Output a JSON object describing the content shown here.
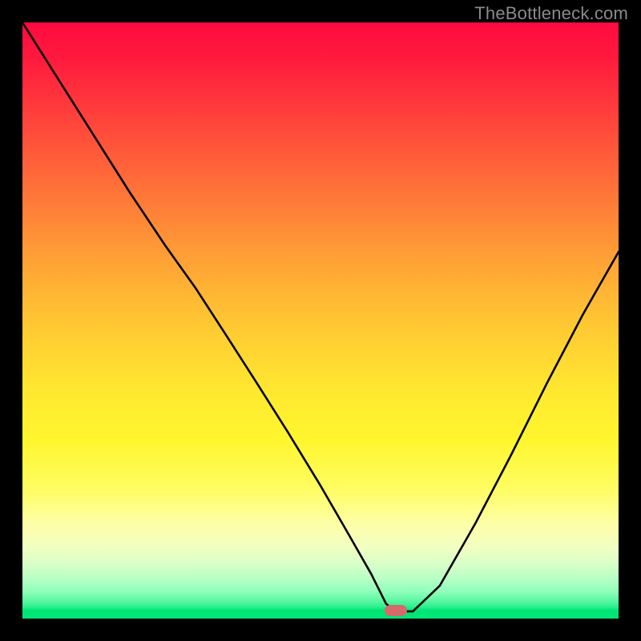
{
  "watermark": "TheBottleneck.com",
  "marker": {
    "color": "#d66a6a",
    "x_frac": 0.626,
    "y_frac": 0.987,
    "w": 28,
    "h": 14
  },
  "chart_data": {
    "type": "line",
    "title": "",
    "xlabel": "",
    "ylabel": "",
    "xlim": [
      0,
      1
    ],
    "ylim": [
      0,
      1
    ],
    "grid": false,
    "legend": false,
    "series": [
      {
        "name": "bottleneck-curve",
        "x": [
          0.0,
          0.06,
          0.12,
          0.18,
          0.24,
          0.29,
          0.34,
          0.39,
          0.445,
          0.5,
          0.545,
          0.585,
          0.61,
          0.625,
          0.655,
          0.7,
          0.76,
          0.82,
          0.88,
          0.94,
          1.0
        ],
        "y": [
          1.0,
          0.905,
          0.81,
          0.715,
          0.625,
          0.555,
          0.478,
          0.4,
          0.313,
          0.223,
          0.145,
          0.075,
          0.025,
          0.012,
          0.012,
          0.055,
          0.16,
          0.275,
          0.395,
          0.51,
          0.615
        ]
      }
    ],
    "annotations": [
      {
        "type": "marker",
        "shape": "rounded-rect",
        "x": 0.626,
        "y": 0.013,
        "label": "optimal-point"
      }
    ],
    "background_gradient": {
      "direction": "vertical",
      "stops": [
        {
          "pos": 0.0,
          "color": "#ff0a40"
        },
        {
          "pos": 0.3,
          "color": "#ff7a38"
        },
        {
          "pos": 0.62,
          "color": "#ffe830"
        },
        {
          "pos": 0.84,
          "color": "#feffa6"
        },
        {
          "pos": 0.95,
          "color": "#8effba"
        },
        {
          "pos": 1.0,
          "color": "#00e676"
        }
      ]
    }
  }
}
